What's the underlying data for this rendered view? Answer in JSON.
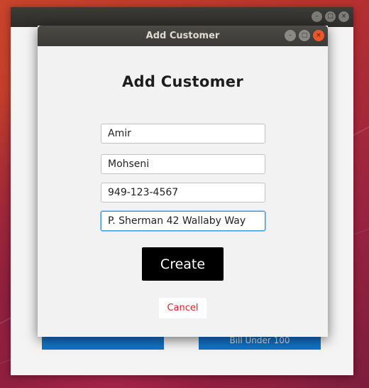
{
  "main_window": {
    "buttons": {
      "left_label": "",
      "right_label": "Bill Under 100"
    },
    "controls": {
      "minimize": "–",
      "maximize": "□",
      "close": "×"
    }
  },
  "dialog": {
    "title": "Add Customer",
    "heading": "Add Customer",
    "controls": {
      "minimize": "–",
      "maximize": "□",
      "close": "×"
    },
    "fields": {
      "first_name": "Amir",
      "last_name": "Mohseni",
      "phone": "949-123-4567",
      "address": "P. Sherman 42 Wallaby Way"
    },
    "create_label": "Create",
    "cancel_label": "Cancel"
  },
  "colors": {
    "create_bg": "#000000",
    "cancel_text": "#d9202c",
    "main_button_bg": "#1273c6",
    "focus_border": "#3f9ad8"
  }
}
